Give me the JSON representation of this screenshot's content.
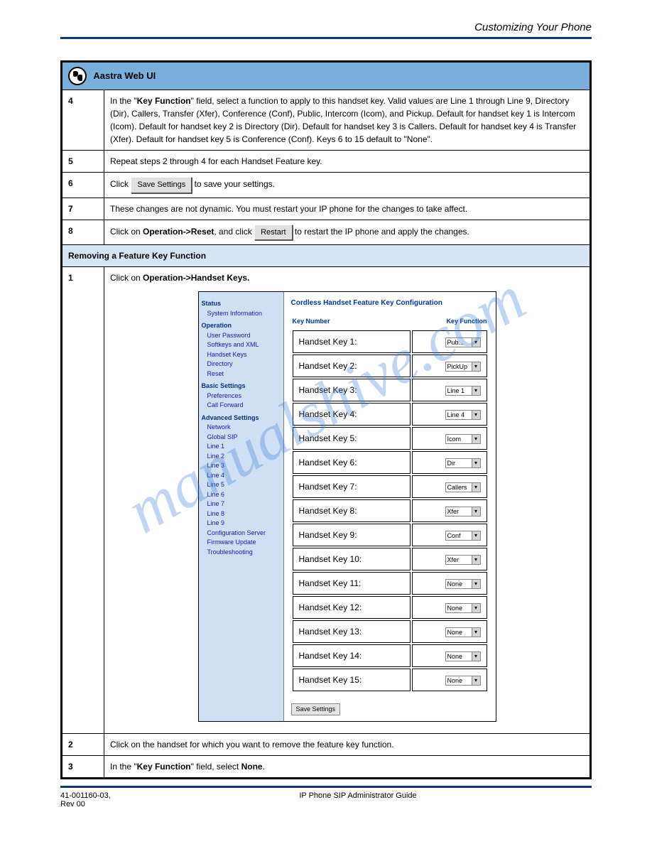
{
  "doc_title": "Customizing Your Phone",
  "watermark": "manualshive.com",
  "header_bar": "Aastra Web UI",
  "rows": {
    "r1": {
      "step": "4",
      "body_a": "In the \"",
      "body_bold": "Key Function",
      "body_b": "\" field, select a function to apply to this handset key. Valid values are Line 1 through Line 9, Directory (Dir), Callers, Transfer (Xfer), Conference (Conf), Public, Intercom (Icom), and Pickup. Default for handset key 1 is Intercom (Icom). Default for handset key 2 is Directory (Dir). Default for handset key 3 is Callers. Default for handset key 4 is Transfer (Xfer). Default for handset key 5 is Conference (Conf). Keys 6 to 15 default to \"None\"."
    },
    "r2": {
      "step": "5",
      "text": "Repeat steps 2 through 4 for each Handset Feature key."
    },
    "r3": {
      "step": "6",
      "text_a": "Click",
      "text_b": " to save your settings."
    },
    "save_btn": "Save Settings",
    "r4": {
      "step": "7",
      "text": "These changes are not dynamic. You must restart your IP phone for the changes to take affect."
    },
    "r5": {
      "step": "8",
      "text_a": "Click on ",
      "bold": "Operation->Reset",
      "text_b": ", and click ",
      "text_c": " to restart the IP phone and apply the changes."
    },
    "restart_btn": "Restart",
    "section": "Removing a Feature Key Function",
    "r6": {
      "step": "1",
      "text_a": "Click on ",
      "bold": "Operation->Handset Keys.",
      "text_b": ""
    },
    "r7": {
      "step": "2",
      "text": "Click on the handset for which you want to remove the feature key function."
    },
    "r8": {
      "step": "3",
      "text_a": "In the \"",
      "bold": "Key Function",
      "text_b": "\" field, select ",
      "bold2": "None",
      "text_c": "."
    }
  },
  "embedded": {
    "title": "Cordless Handset Feature Key Configuration",
    "col1": "Key Number",
    "col2": "Key Function",
    "side": {
      "status": "Status",
      "sysinfo": "System Information",
      "operation": "Operation",
      "userpw": "User Password",
      "softkeys": "Softkeys and XML",
      "hkeys": "Handset Keys",
      "directory": "Directory",
      "reset": "Reset",
      "basic": "Basic Settings",
      "prefs": "Preferences",
      "cfw": "Call Forward",
      "adv": "Advanced Settings",
      "network": "Network",
      "gsip": "Global SIP",
      "l1": "Line 1",
      "l2": "Line 2",
      "l3": "Line 3",
      "l4": "Line 4",
      "l5": "Line 5",
      "l6": "Line 6",
      "l7": "Line 7",
      "l8": "Line 8",
      "l9": "Line 9",
      "cfg": "Configuration Server",
      "fw": "Firmware Update",
      "tb": "Troubleshooting"
    },
    "keys": [
      {
        "label": "Handset Key 1:",
        "val": "Pub..."
      },
      {
        "label": "Handset Key 2:",
        "val": "PickUp"
      },
      {
        "label": "Handset Key 3:",
        "val": "Line 1"
      },
      {
        "label": "Handset Key 4:",
        "val": "Line 4"
      },
      {
        "label": "Handset Key 5:",
        "val": "Icom"
      },
      {
        "label": "Handset Key 6:",
        "val": "Dir"
      },
      {
        "label": "Handset Key 7:",
        "val": "Callers"
      },
      {
        "label": "Handset Key 8:",
        "val": "Xfer"
      },
      {
        "label": "Handset Key 9:",
        "val": "Conf"
      },
      {
        "label": "Handset Key 10:",
        "val": "Xfer"
      },
      {
        "label": "Handset Key 11:",
        "val": "None"
      },
      {
        "label": "Handset Key 12:",
        "val": "None"
      },
      {
        "label": "Handset Key 13:",
        "val": "None"
      },
      {
        "label": "Handset Key 14:",
        "val": "None"
      },
      {
        "label": "Handset Key 15:",
        "val": "None"
      }
    ],
    "save_btn": "Save Settings"
  },
  "footer": {
    "left": "41-001160-03, Rev 00",
    "right": "IP Phone SIP Administrator Guide",
    "page_hint": ""
  }
}
